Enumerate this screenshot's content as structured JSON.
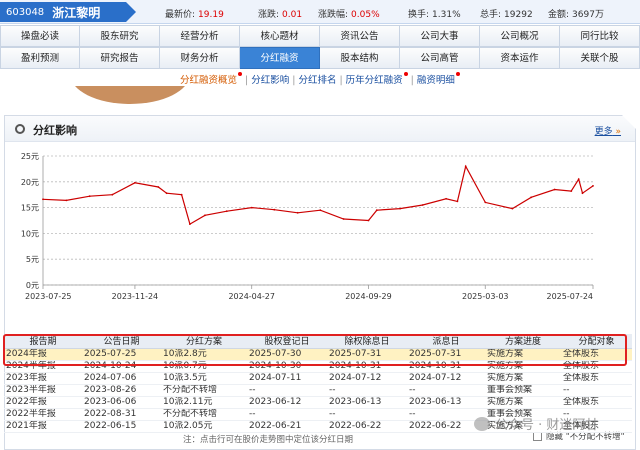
{
  "header": {
    "code": "603048",
    "name": "浙江黎明",
    "quotes": [
      {
        "label": "最新价:",
        "value": "19.19",
        "kind": "red"
      },
      {
        "label": "涨跌:",
        "value": "0.01",
        "kind": "red"
      },
      {
        "label": "涨跌幅:",
        "value": "0.05%",
        "kind": "red"
      },
      {
        "label": "换手:",
        "value": "1.31%",
        "kind": "plain"
      },
      {
        "label": "总手:",
        "value": "19292",
        "kind": "plain"
      },
      {
        "label": "金额:",
        "value": "3697万",
        "kind": "plain"
      }
    ]
  },
  "tabs_row1": [
    "操盘必读",
    "股东研究",
    "经营分析",
    "核心题材",
    "资讯公告",
    "公司大事",
    "公司概况",
    "同行比较"
  ],
  "tabs_row2": [
    "盈利预测",
    "研究报告",
    "财务分析",
    "分红融资",
    "股本结构",
    "公司高管",
    "资本运作",
    "关联个股"
  ],
  "active_tab": "分红融资",
  "subnav": [
    {
      "label": "分红融资概览",
      "dot": true,
      "current": true
    },
    {
      "label": "分红影响",
      "dot": false,
      "current": false
    },
    {
      "label": "分红排名",
      "dot": false,
      "current": false
    },
    {
      "label": "历年分红融资",
      "dot": true,
      "current": false
    },
    {
      "label": "融资明细",
      "dot": true,
      "current": false
    }
  ],
  "panel": {
    "title": "分红影响",
    "more": "更多"
  },
  "chart_data": {
    "type": "line",
    "title": "",
    "ylim": [
      0,
      25
    ],
    "yticks": [
      "0元",
      "5元",
      "10元",
      "15元",
      "20元",
      "25元"
    ],
    "xticks": [
      "2023-07-25",
      "2023-11-24",
      "2024-04-27",
      "2024-09-29",
      "2025-03-03",
      "2025-07-24"
    ],
    "color": "#cc0000",
    "grid": true,
    "x": [
      "2023-07-25",
      "2023-08-25",
      "2023-09-25",
      "2023-10-25",
      "2023-11-24",
      "2023-12-25",
      "2024-01-05",
      "2024-01-25",
      "2024-02-05",
      "2024-02-25",
      "2024-03-25",
      "2024-04-27",
      "2024-05-27",
      "2024-06-27",
      "2024-07-27",
      "2024-08-27",
      "2024-09-29",
      "2024-10-10",
      "2024-11-10",
      "2024-12-10",
      "2025-01-10",
      "2025-01-25",
      "2025-02-05",
      "2025-03-03",
      "2025-04-08",
      "2025-05-03",
      "2025-06-03",
      "2025-06-25",
      "2025-07-05",
      "2025-07-10",
      "2025-07-24"
    ],
    "values": [
      16.6,
      16.4,
      17.2,
      17.5,
      19.8,
      19.0,
      17.8,
      17.5,
      11.8,
      13.5,
      14.3,
      15.0,
      14.6,
      14.0,
      14.5,
      12.8,
      12.5,
      14.5,
      14.8,
      15.5,
      16.7,
      16.2,
      23.0,
      16.0,
      14.8,
      17.0,
      18.5,
      18.2,
      20.5,
      17.8,
      19.2
    ]
  },
  "note": "注：点击行可在股价走势图中定位该分红日期",
  "hide_label": "隐藏 \"不分配不转增\"",
  "table": {
    "headers": [
      "报告期",
      "公告日期",
      "分红方案",
      "股权登记日",
      "除权除息日",
      "派息日",
      "方案进度",
      "分配对象"
    ],
    "rows": [
      [
        "2024年报",
        "2025-07-25",
        "10派2.8元",
        "2025-07-30",
        "2025-07-31",
        "2025-07-31",
        "实施方案",
        "全体股东"
      ],
      [
        "2024半年报",
        "2024-10-24",
        "10派0.7元",
        "2024-10-30",
        "2024-10-31",
        "2024-10-31",
        "实施方案",
        "全体股东"
      ],
      [
        "2023年报",
        "2024-07-06",
        "10派3.5元",
        "2024-07-11",
        "2024-07-12",
        "2024-07-12",
        "实施方案",
        "全体股东"
      ],
      [
        "2023半年报",
        "2023-08-26",
        "不分配不转增",
        "--",
        "--",
        "--",
        "董事会预案",
        "--"
      ],
      [
        "2022年报",
        "2023-06-06",
        "10派2.11元",
        "2023-06-12",
        "2023-06-13",
        "2023-06-13",
        "实施方案",
        "全体股东"
      ],
      [
        "2022半年报",
        "2022-08-31",
        "不分配不转增",
        "--",
        "--",
        "--",
        "董事会预案",
        "--"
      ],
      [
        "2021年报",
        "2022-06-15",
        "10派2.05元",
        "2022-06-21",
        "2022-06-22",
        "2022-06-22",
        "实施方案",
        "全体股东"
      ]
    ]
  },
  "watermark": "公众号 · 财迷阿甘"
}
